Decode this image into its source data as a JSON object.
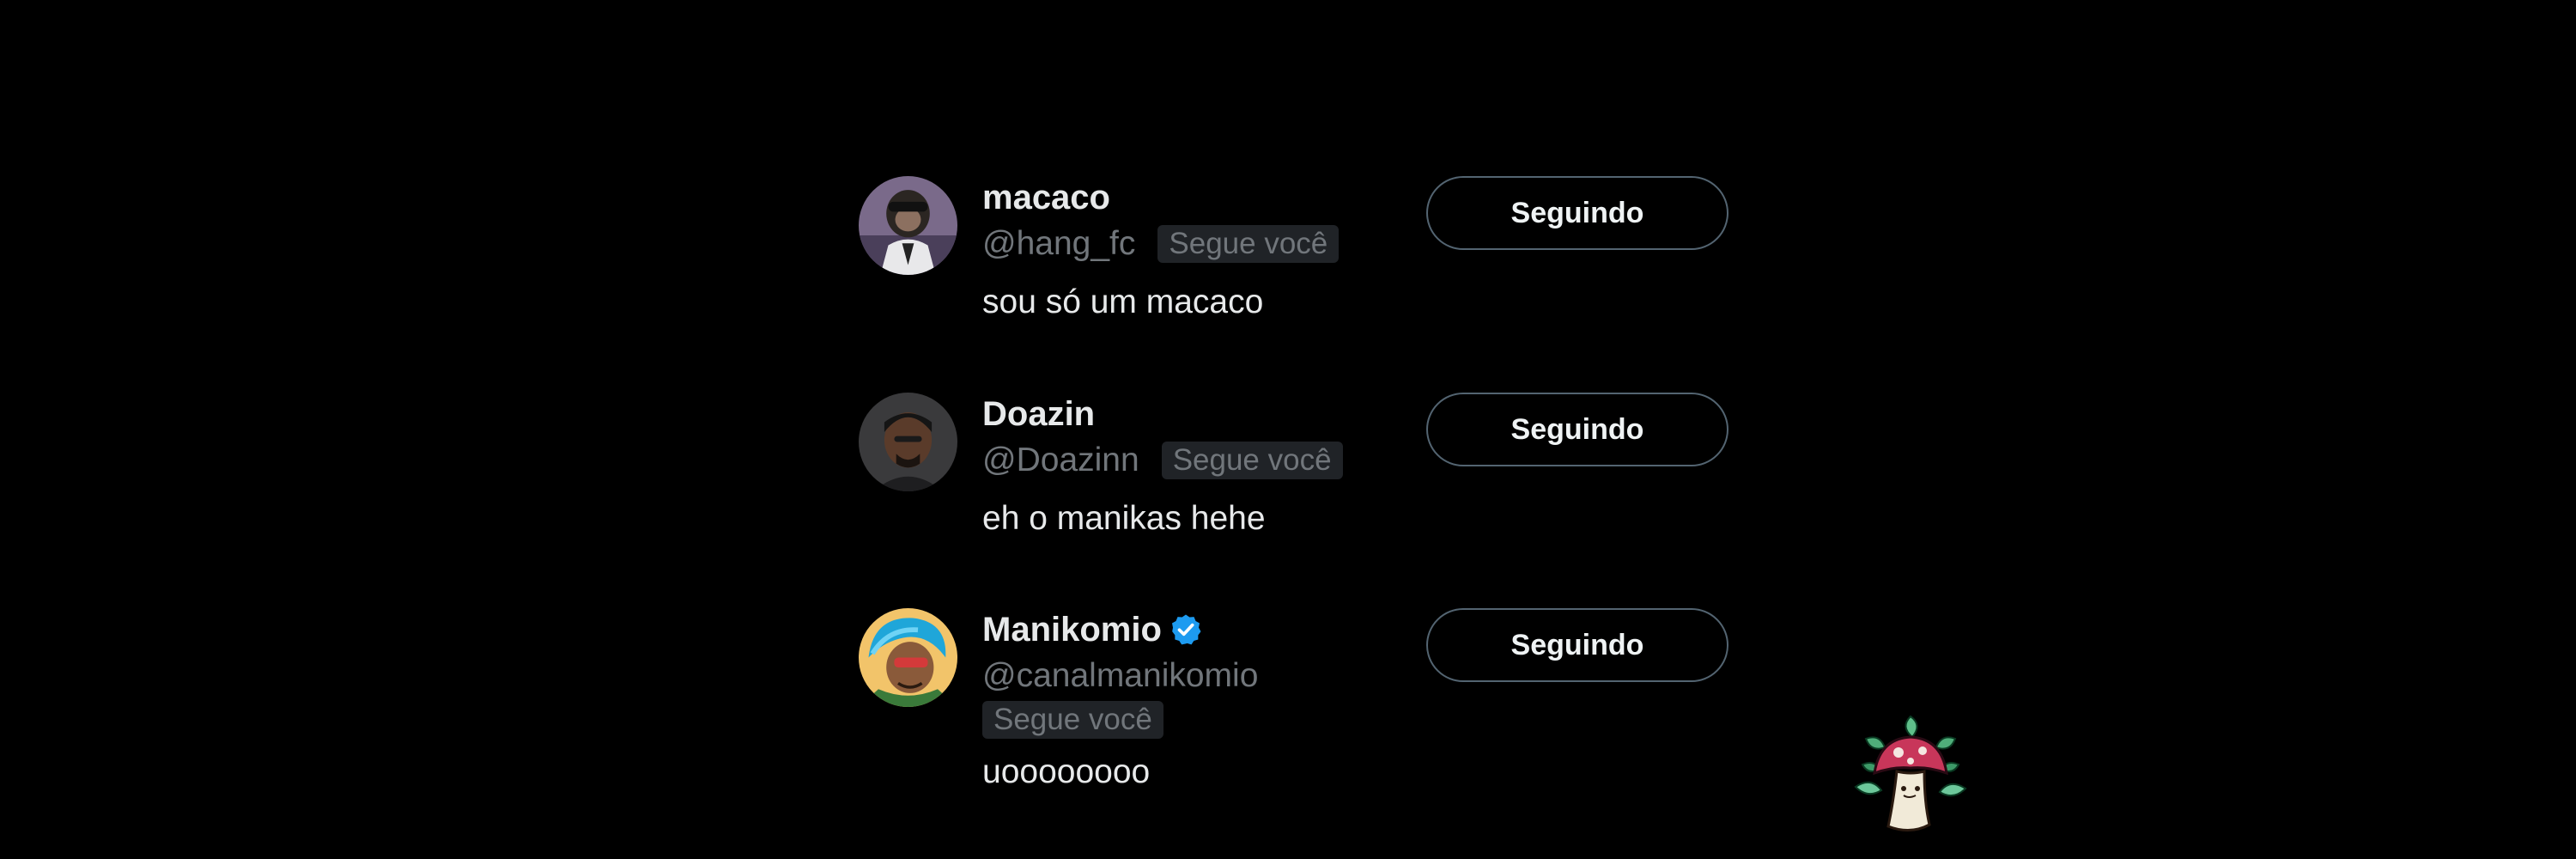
{
  "users": [
    {
      "display_name": "macaco",
      "handle": "@hang_fc",
      "follows_you": "Segue você",
      "bio": "sou só um macaco",
      "button_label": "Seguindo",
      "verified": false,
      "avatar_icon": "monkey-avatar"
    },
    {
      "display_name": "Doazin",
      "handle": "@Doazinn",
      "follows_you": "Segue você",
      "bio": "eh o manikas hehe",
      "button_label": "Seguindo",
      "verified": false,
      "avatar_icon": "person-avatar"
    },
    {
      "display_name": "Manikomio",
      "handle": "@canalmanikomio",
      "follows_you": "Segue você",
      "bio": "uoooooooo",
      "button_label": "Seguindo",
      "verified": true,
      "avatar_icon": "cartoon-avatar"
    }
  ],
  "colors": {
    "background": "#000000",
    "text_primary": "#e7e9ea",
    "text_secondary": "#71767b",
    "badge_bg": "#202327",
    "button_border": "#536471",
    "verified": "#1d9bf0"
  },
  "icons": {
    "verified": "verified-badge-icon",
    "logo": "mushroom-logo"
  }
}
